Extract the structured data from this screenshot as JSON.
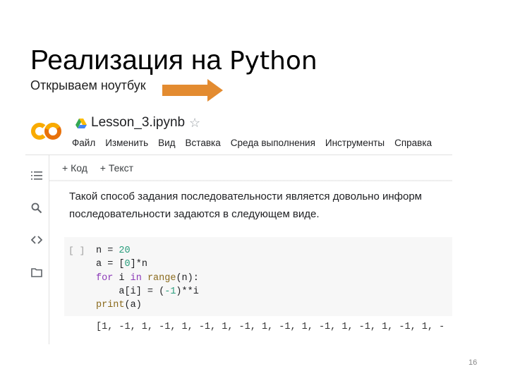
{
  "slide": {
    "title_main": "Реализация на ",
    "title_python": "Python",
    "subtitle": "Открываем ноутбук",
    "page_number": "16",
    "arrow_color": "#e38b30"
  },
  "notebook": {
    "logo_text": "CO",
    "file_name": "Lesson_3.ipynb",
    "star_icon": "☆",
    "menu": [
      "Файл",
      "Изменить",
      "Вид",
      "Вставка",
      "Среда выполнения",
      "Инструменты",
      "Справка"
    ],
    "toolbar": {
      "add_code": "+ Код",
      "add_text": "+ Текст"
    },
    "sidebar_icons": [
      "table-of-contents-icon",
      "search-icon",
      "code-snippets-icon",
      "files-icon"
    ],
    "text_cell": {
      "line1": "Такой способ задания последовательности является довольно информ",
      "line2": "последовательности задаются в следующем виде."
    },
    "code_cell": {
      "run_indicator": "[ ]",
      "lines": {
        "l1_a": "n = ",
        "l1_num": "20",
        "l2_a": "a = [",
        "l2_num": "0",
        "l2_b": "]*n",
        "l3_kw1": "for",
        "l3_a": " i ",
        "l3_kw2": "in",
        "l3_sp": " ",
        "l3_bi": "range",
        "l3_b": "(n):",
        "l4_a": "    a[i] = (",
        "l4_num": "-1",
        "l4_b": ")**i",
        "l5_bi": "print",
        "l5_b": "(a)"
      }
    },
    "output": "[1, -1, 1, -1, 1, -1, 1, -1, 1, -1, 1, -1, 1, -1, 1, -1, 1, -"
  }
}
